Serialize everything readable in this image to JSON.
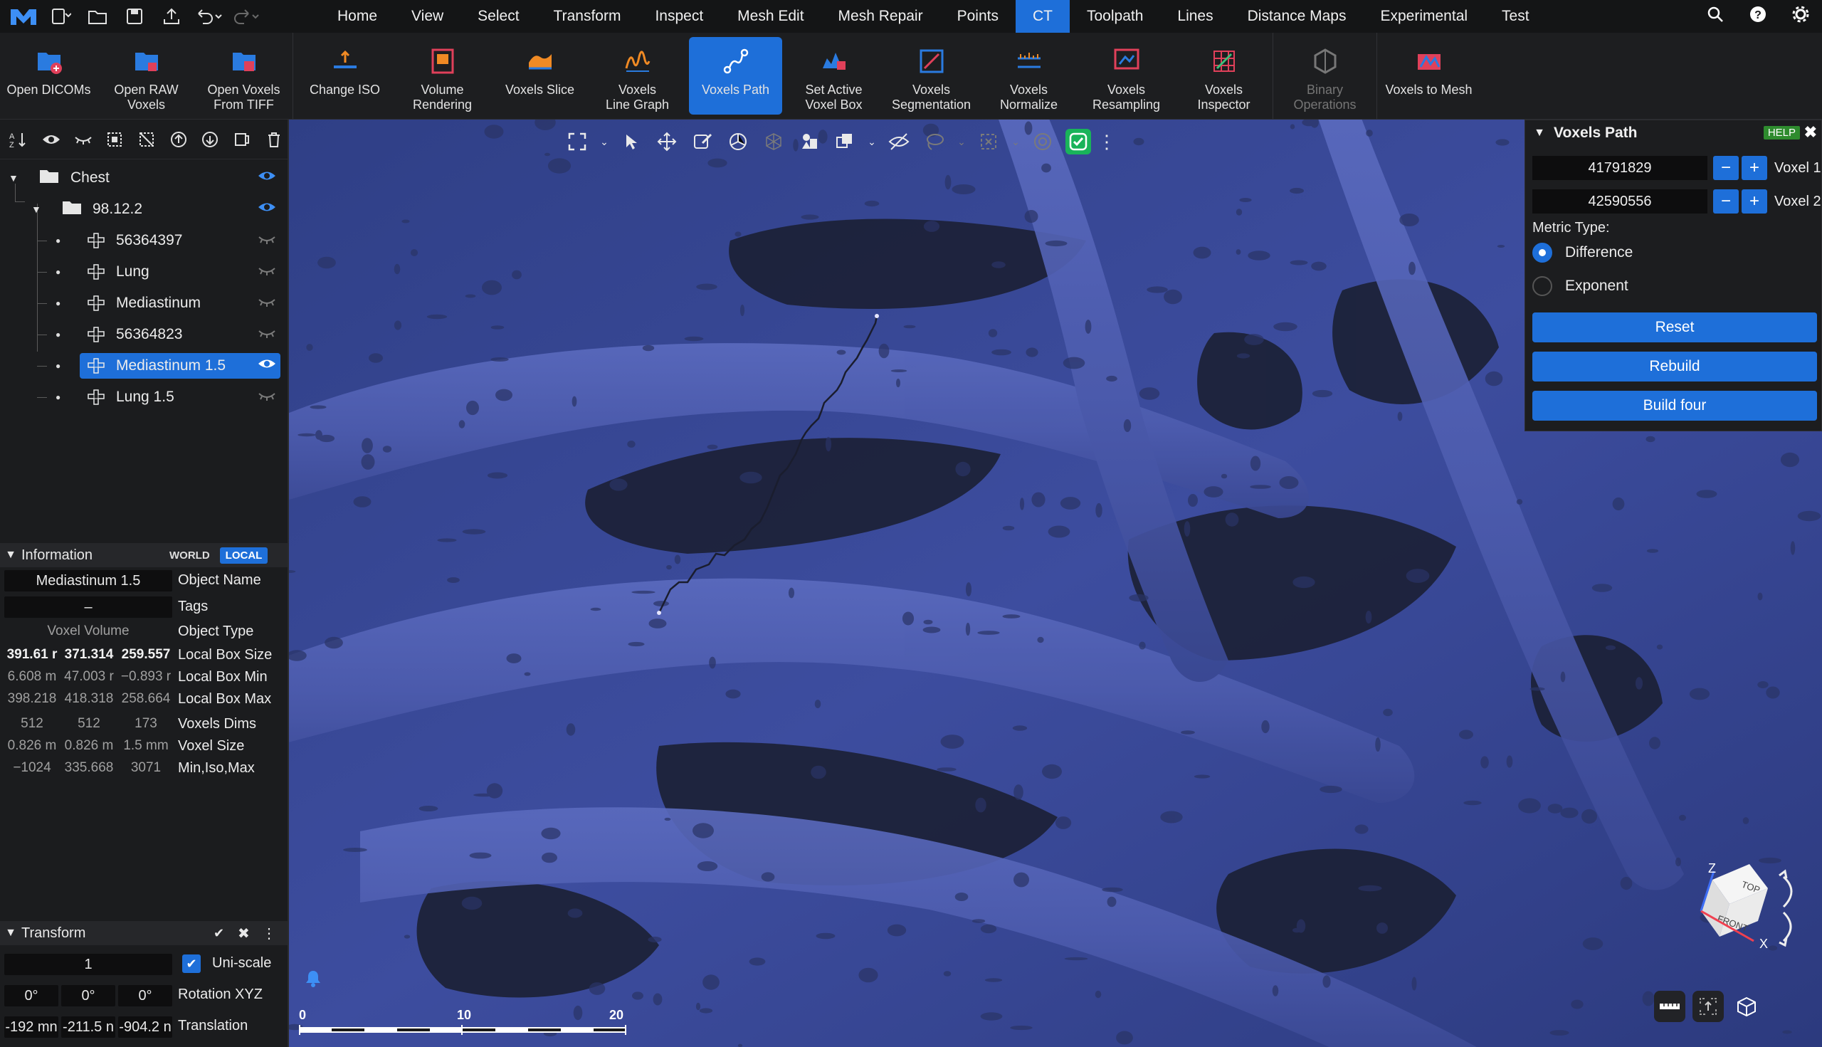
{
  "menubar": {
    "items": [
      "Home",
      "View",
      "Select",
      "Transform",
      "Inspect",
      "Mesh Edit",
      "Mesh Repair",
      "Points",
      "CT",
      "Toolpath",
      "Lines",
      "Distance Maps",
      "Experimental",
      "Test"
    ],
    "active": "CT"
  },
  "ribbon": {
    "buttons": [
      {
        "l1": "Open DICOMs",
        "l2": ""
      },
      {
        "l1": "Open RAW",
        "l2": "Voxels"
      },
      {
        "l1": "Open Voxels",
        "l2": "From TIFF"
      },
      {
        "l1": "Change ISO",
        "l2": ""
      },
      {
        "l1": "Volume",
        "l2": "Rendering"
      },
      {
        "l1": "Voxels Slice",
        "l2": ""
      },
      {
        "l1": "Voxels",
        "l2": "Line Graph"
      },
      {
        "l1": "Voxels Path",
        "l2": ""
      },
      {
        "l1": "Set Active",
        "l2": "Voxel Box"
      },
      {
        "l1": "Voxels",
        "l2": "Segmentation"
      },
      {
        "l1": "Voxels",
        "l2": "Normalize"
      },
      {
        "l1": "Voxels",
        "l2": "Resampling"
      },
      {
        "l1": "Voxels",
        "l2": "Inspector"
      },
      {
        "l1": "Binary",
        "l2": "Operations"
      },
      {
        "l1": "Voxels to Mesh",
        "l2": ""
      }
    ]
  },
  "tree": {
    "root": "Chest",
    "folder": "98.12.2",
    "items": [
      "56364397",
      "Lung",
      "Mediastinum",
      "56364823",
      "Mediastinum 1.5",
      "Lung 1.5"
    ],
    "selected": "Mediastinum 1.5"
  },
  "information": {
    "title": "Information",
    "world": "WORLD",
    "local": "LOCAL",
    "object_name": "Mediastinum 1.5",
    "tags": "–",
    "object_type": "Voxel Volume",
    "labels": {
      "object_name": "Object Name",
      "tags": "Tags",
      "object_type": "Object Type",
      "box_size": "Local Box Size",
      "box_min": "Local Box Min",
      "box_max": "Local Box Max",
      "dims": "Voxels Dims",
      "voxel_size": "Voxel Size",
      "minisomax": "Min,Iso,Max"
    },
    "box_size": [
      "391.61 r",
      "371.314",
      "259.557"
    ],
    "box_min": [
      "6.608 m",
      "47.003 r",
      "−0.893 r"
    ],
    "box_max": [
      "398.218",
      "418.318",
      "258.664"
    ],
    "dims": [
      "512",
      "512",
      "173"
    ],
    "voxel_size": [
      "0.826 m",
      "0.826 m",
      "1.5 mm"
    ],
    "minisomax": [
      "−1024",
      "335.668",
      "3071"
    ]
  },
  "transform": {
    "title": "Transform",
    "scale": "1",
    "uniscale_label": "Uni-scale",
    "rotation": [
      "0°",
      "0°",
      "0°"
    ],
    "rotation_label": "Rotation XYZ",
    "translation": [
      "-192 mn",
      "-211.5 n",
      "-904.2 n"
    ],
    "translation_label": "Translation"
  },
  "voxels_path": {
    "title": "Voxels Path",
    "help": "HELP",
    "voxel1_value": "41791829",
    "voxel1_label": "Voxel 1",
    "voxel2_value": "42590556",
    "voxel2_label": "Voxel 2",
    "metric_label": "Metric Type:",
    "metric_options": [
      "Difference",
      "Exponent"
    ],
    "metric_selected": "Difference",
    "reset": "Reset",
    "rebuild": "Rebuild",
    "build_four": "Build four"
  },
  "scale_bar": {
    "ticks": [
      "0",
      "10",
      "20"
    ]
  },
  "view_cube": {
    "top": "TOP",
    "front": "FRONT",
    "z": "Z",
    "x": "X"
  },
  "colors": {
    "accent": "#1e6fd9",
    "bg": "#1b1c1e",
    "volume": "#3a4a9a"
  }
}
